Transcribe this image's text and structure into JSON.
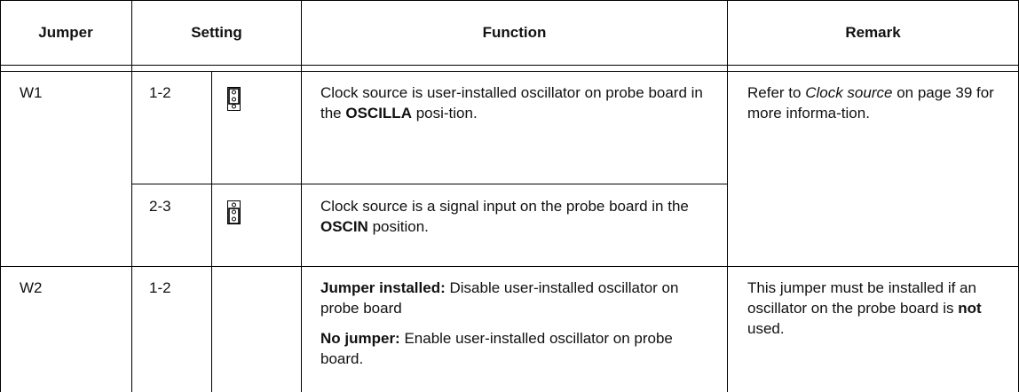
{
  "table": {
    "headers": {
      "jumper": "Jumper",
      "setting": "Setting",
      "function": "Function",
      "remark": "Remark"
    },
    "rows": [
      {
        "jumper": "W1",
        "setting": "1-2",
        "jumper_icon": "jumper-1-2-icon",
        "function": [
          "Clock source is user-installed oscillator on probe board in the ",
          "OSCILLA",
          " posi-tion."
        ],
        "remark": [
          "Refer to ",
          "Clock source",
          " on page 39 for more informa-tion."
        ]
      },
      {
        "setting": "2-3",
        "jumper_icon": "jumper-2-3-icon",
        "function": [
          "Clock source is a signal input on the probe board in the ",
          "OSCIN",
          " position."
        ]
      },
      {
        "jumper": "W2",
        "setting": "1-2",
        "function_a": [
          "Jumper installed:",
          " Disable user-installed oscillator on probe board"
        ],
        "function_b": [
          "No jumper:",
          " Enable user-installed oscillator on probe board."
        ],
        "remark": [
          "This jumper must be installed if an oscillator on the probe board is ",
          "not",
          " used."
        ]
      }
    ]
  }
}
